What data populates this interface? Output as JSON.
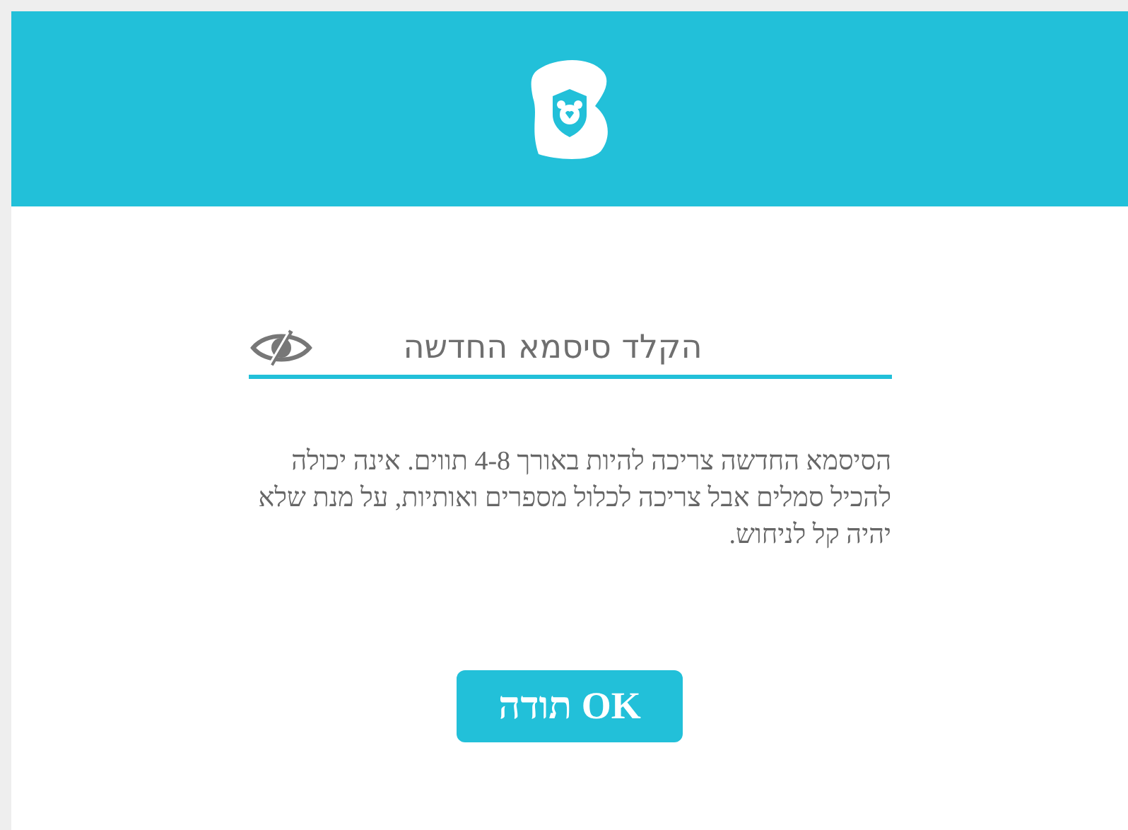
{
  "header": {
    "kind": "logo"
  },
  "password_field": {
    "placeholder": "הקלד סיסמא החדשה",
    "visible": false
  },
  "description": "הסיסמא החדשה צריכה להיות באורך 4-8 תווים. אינה יכולה להכיל סמלים אבל צריכה לכלול מספרים ואותיות, על מנת שלא יהיה קל לניחוש.",
  "button": {
    "label": "OK תודה"
  }
}
